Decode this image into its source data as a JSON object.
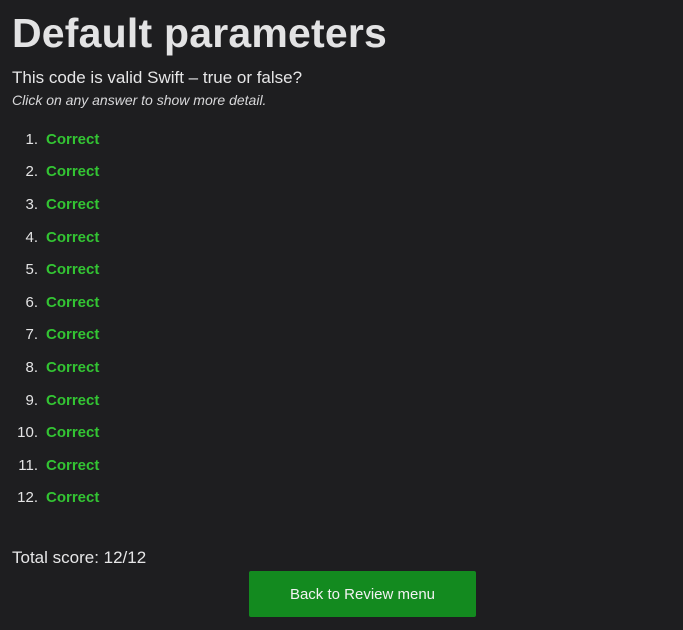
{
  "header": {
    "title": "Default parameters",
    "question": "This code is valid Swift – true or false?",
    "hint": "Click on any answer to show more detail."
  },
  "answers": [
    {
      "number": "1.",
      "status": "Correct"
    },
    {
      "number": "2.",
      "status": "Correct"
    },
    {
      "number": "3.",
      "status": "Correct"
    },
    {
      "number": "4.",
      "status": "Correct"
    },
    {
      "number": "5.",
      "status": "Correct"
    },
    {
      "number": "6.",
      "status": "Correct"
    },
    {
      "number": "7.",
      "status": "Correct"
    },
    {
      "number": "8.",
      "status": "Correct"
    },
    {
      "number": "9.",
      "status": "Correct"
    },
    {
      "number": "10.",
      "status": "Correct"
    },
    {
      "number": "11.",
      "status": "Correct"
    },
    {
      "number": "12.",
      "status": "Correct"
    }
  ],
  "score": {
    "text": "Total score: 12/12"
  },
  "actions": {
    "back_label": "Back to Review menu"
  },
  "colors": {
    "background": "#1e1e20",
    "correct": "#33c433",
    "button": "#138a1f"
  }
}
